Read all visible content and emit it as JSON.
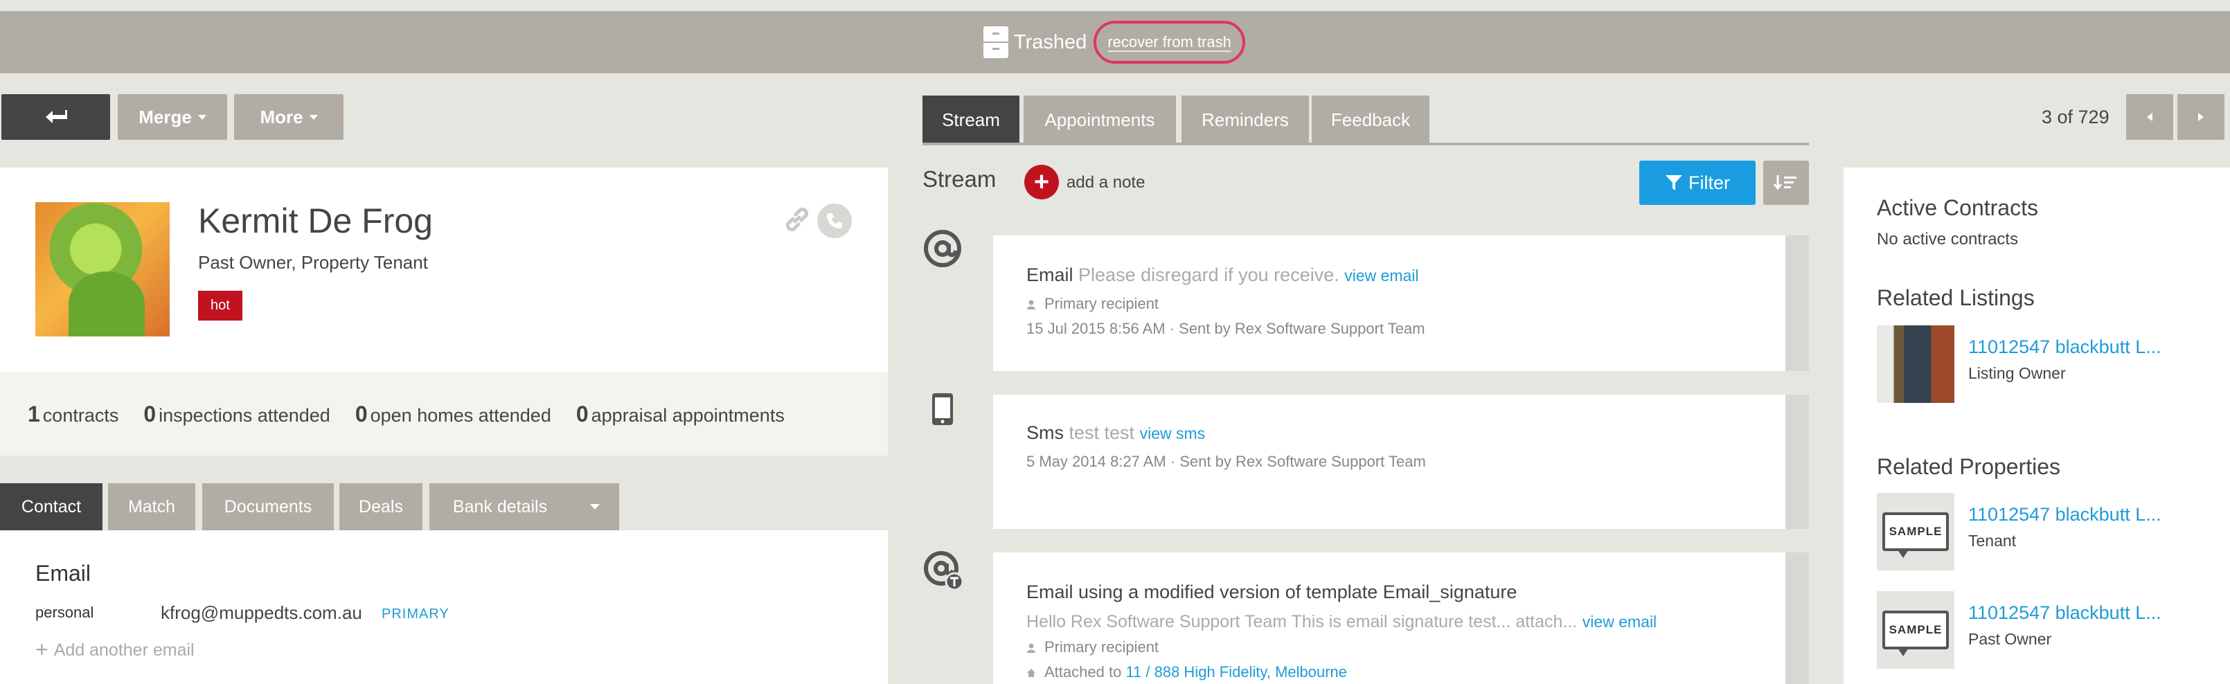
{
  "banner": {
    "label": "Trashed",
    "recover_label": "recover from trash"
  },
  "toolbar": {
    "merge_label": "Merge",
    "more_label": "More"
  },
  "contact": {
    "name": "Kermit De Frog",
    "roles": "Past Owner, Property Tenant",
    "tag": "hot"
  },
  "stats": [
    {
      "count": "1",
      "label": "contracts"
    },
    {
      "count": "0",
      "label": "inspections attended"
    },
    {
      "count": "0",
      "label": "open homes attended"
    },
    {
      "count": "0",
      "label": "appraisal appointments"
    }
  ],
  "left_tabs": [
    "Contact",
    "Match",
    "Documents",
    "Deals",
    "Bank details"
  ],
  "email_section": {
    "title": "Email",
    "type": "personal",
    "address": "kfrog@muppedts.com.au",
    "primary_label": "PRIMARY",
    "add_label": "Add another email"
  },
  "center_tabs": [
    "Stream",
    "Appointments",
    "Reminders",
    "Feedback"
  ],
  "stream": {
    "title": "Stream",
    "add_note_label": "add a note",
    "filter_label": "Filter",
    "items": [
      {
        "kind": "Email",
        "summary": "Please disregard if you receive.",
        "link": "view email",
        "recipient": "Primary recipient",
        "meta": "15 Jul 2015 8:56 AM · Sent by Rex Software Support Team"
      },
      {
        "kind": "Sms",
        "summary": "test test",
        "link": "view sms",
        "meta": "5 May 2014 8:27 AM · Sent by Rex Software Support Team"
      },
      {
        "kind": "Email",
        "summary_prefix": "using a modified version of template",
        "template": "Email_signature",
        "preview": "Hello Rex Software Support Team   This is email signature test... attach...",
        "link": "view email",
        "recipient": "Primary recipient",
        "attached_prefix": "Attached to",
        "attached_link": "11 / 888 High Fidelity, Melbourne"
      }
    ]
  },
  "pagination": {
    "label": "3 of 729"
  },
  "right_panel": {
    "active_contracts_title": "Active Contracts",
    "active_contracts_empty": "No active contracts",
    "related_listings_title": "Related Listings",
    "listings": [
      {
        "title": "11012547 blackbutt L...",
        "role": "Listing Owner"
      }
    ],
    "related_properties_title": "Related Properties",
    "properties": [
      {
        "title": "11012547 blackbutt L...",
        "role": "Tenant",
        "thumb_label": "SAMPLE"
      },
      {
        "title": "11012547 blackbutt L...",
        "role": "Past Owner",
        "thumb_label": "SAMPLE"
      }
    ]
  },
  "colors": {
    "accent": "#1a9de0",
    "danger": "#c1121f",
    "neutral_button": "#b1ada5",
    "dark_button": "#444444"
  }
}
